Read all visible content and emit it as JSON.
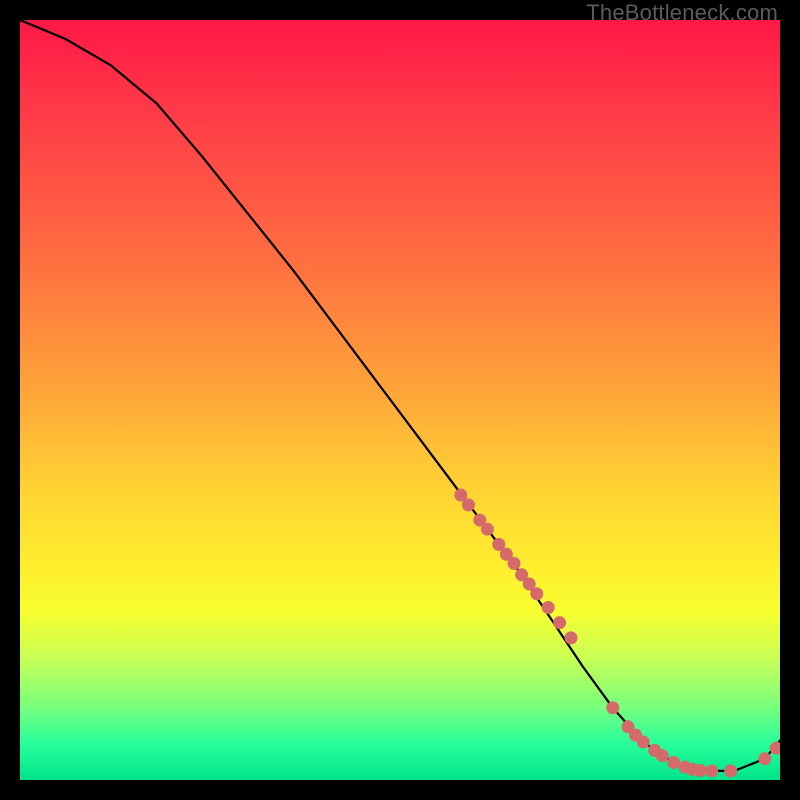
{
  "watermark": "TheBottleneck.com",
  "chart_data": {
    "type": "line",
    "title": "",
    "xlabel": "",
    "ylabel": "",
    "xlim": [
      0,
      100
    ],
    "ylim": [
      0,
      100
    ],
    "grid": false,
    "legend": false,
    "series": [
      {
        "name": "curve",
        "x": [
          0,
          6,
          12,
          18,
          24,
          30,
          36,
          42,
          48,
          54,
          60,
          66,
          70,
          74,
          78,
          82,
          86,
          90,
          94,
          98,
          100
        ],
        "y": [
          100,
          97.5,
          94,
          89,
          82,
          74.5,
          67,
          59,
          51,
          43,
          35,
          27,
          21,
          15,
          9.5,
          5,
          2.3,
          1.2,
          1.2,
          2.8,
          5.2
        ]
      }
    ],
    "points": {
      "name": "dots",
      "color": "#d46a6a",
      "x": [
        58,
        59,
        60.5,
        61.5,
        63,
        64,
        65,
        66,
        67,
        68,
        69.5,
        71,
        72.5,
        78,
        80,
        81,
        82,
        83.5,
        84.5,
        86,
        87.5,
        88.5,
        89.5,
        91,
        93.5,
        98,
        99.5
      ],
      "y": [
        37.5,
        36.2,
        34.2,
        33,
        31,
        29.7,
        28.5,
        27,
        25.8,
        24.5,
        22.7,
        20.7,
        18.7,
        9.5,
        7,
        5.9,
        5,
        3.9,
        3.2,
        2.3,
        1.7,
        1.4,
        1.25,
        1.2,
        1.2,
        2.8,
        4.2
      ]
    }
  }
}
